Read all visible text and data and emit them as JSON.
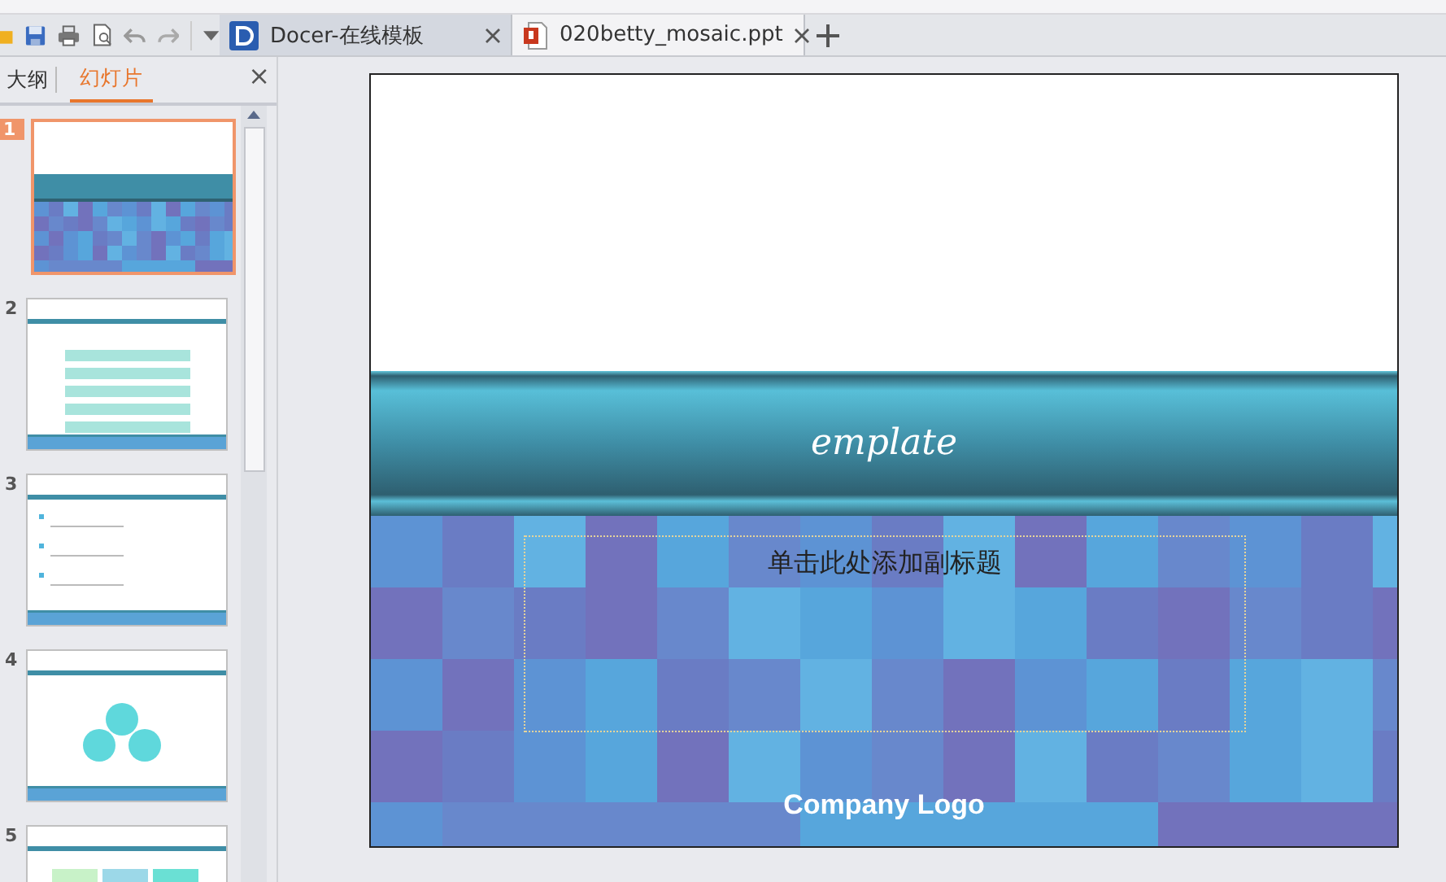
{
  "tabs": [
    {
      "label": "Docer-在线模板",
      "kind": "docer",
      "selected": false
    },
    {
      "label": "020betty_mosaic.ppt",
      "kind": "ppt",
      "selected": true
    }
  ],
  "panel": {
    "tabs": [
      {
        "label": "大纲",
        "selected": false
      },
      {
        "label": "幻灯片",
        "selected": true
      }
    ],
    "close": "×"
  },
  "slides": [
    {
      "number": "1",
      "kind": "title",
      "selected": true
    },
    {
      "number": "2",
      "kind": "bars",
      "selected": false
    },
    {
      "number": "3",
      "kind": "bullets",
      "selected": false
    },
    {
      "number": "4",
      "kind": "cycle",
      "selected": false
    },
    {
      "number": "5",
      "kind": "boxes",
      "selected": false
    }
  ],
  "slide": {
    "title": "emplate",
    "subtitle_placeholder": "单击此处添加副标题",
    "logo": "Company Logo"
  }
}
